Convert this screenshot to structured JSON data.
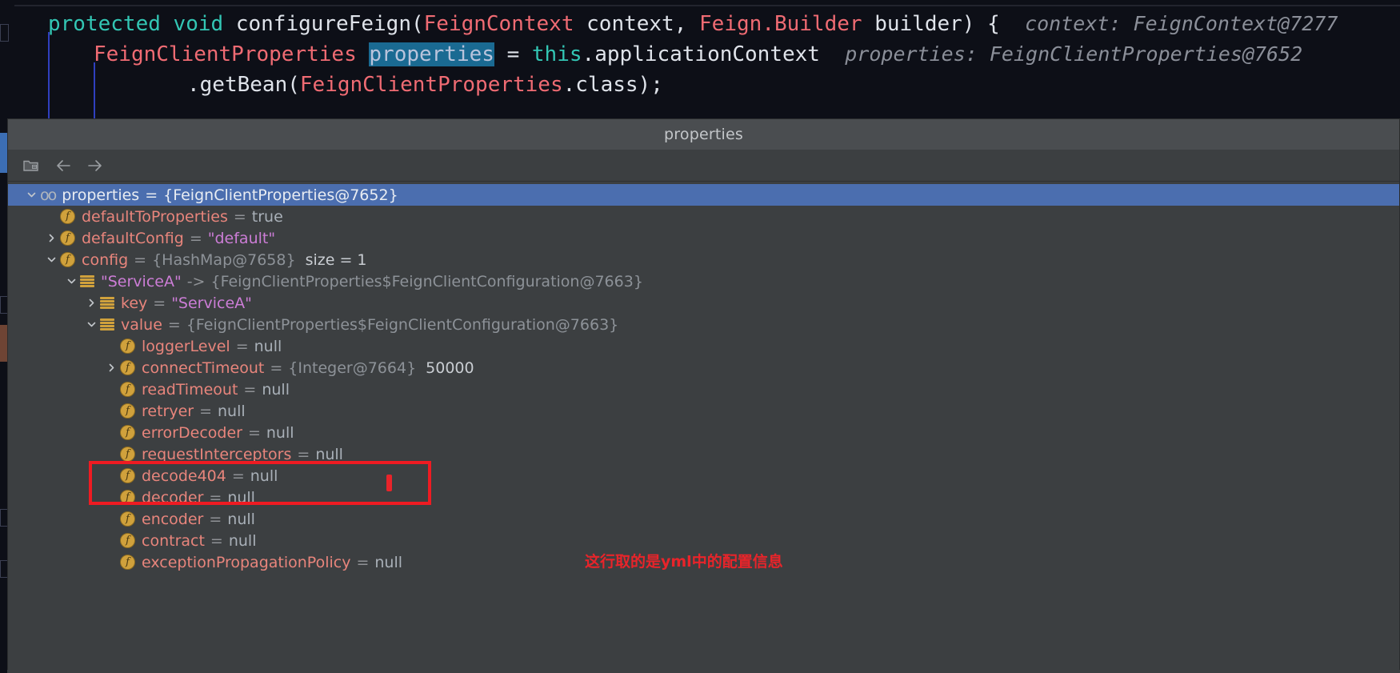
{
  "editor": {
    "line1": {
      "kw_protected": "protected",
      "kw_void": "void",
      "method": "configureFeign",
      "paren_open": "(",
      "type1": "FeignContext",
      "param1": "context",
      "comma": ", ",
      "type2": "Feign",
      "dot": ".",
      "type2b": "Builder",
      "param2": "builder",
      "paren_close": ")",
      "brace": "{",
      "hint": "context: FeignContext@7277"
    },
    "line2": {
      "type": "FeignClientProperties",
      "selected_var": "properties",
      "equals": "=",
      "this_kw": "this",
      "dot": ".",
      "field": "applicationContext",
      "hint": "properties: FeignClientProperties@7652"
    },
    "line3": {
      "call": ".getBean(",
      "arg_type": "FeignClientProperties",
      "arg_rest": ".class);"
    }
  },
  "popup": {
    "title": "properties",
    "toolbar": {
      "items": [
        {
          "name": "show-referring-objects-icon",
          "label": ""
        },
        {
          "name": "back-arrow-icon",
          "label": ""
        },
        {
          "name": "forward-arrow-icon",
          "label": ""
        }
      ]
    },
    "tree": [
      {
        "indent": 0,
        "twisty": "down",
        "icon": "watch-icon",
        "selected": true,
        "name": "properties",
        "eq": "=",
        "value": "{FeignClientProperties@7652}",
        "value_kind": "dim"
      },
      {
        "indent": 1,
        "twisty": "none",
        "icon": "field-icon",
        "selected": false,
        "name": "defaultToProperties",
        "eq": "=",
        "value": "true",
        "value_kind": "plain"
      },
      {
        "indent": 1,
        "twisty": "right",
        "icon": "field-icon",
        "selected": false,
        "name": "defaultConfig",
        "eq": "=",
        "value": "\"default\"",
        "value_kind": "string"
      },
      {
        "indent": 1,
        "twisty": "down",
        "icon": "field-icon",
        "selected": false,
        "name": "config",
        "eq": "=",
        "value": "{HashMap@7658}",
        "value_kind": "dim",
        "extra": "size = 1"
      },
      {
        "indent": 2,
        "twisty": "down",
        "icon": "entry-icon",
        "selected": false,
        "name": "\"ServiceA\"",
        "name_kind": "mapkey",
        "eq": "->",
        "value": "{FeignClientProperties$FeignClientConfiguration@7663}",
        "value_kind": "dim"
      },
      {
        "indent": 3,
        "twisty": "right",
        "icon": "entry-icon",
        "selected": false,
        "name": "key",
        "eq": "=",
        "value": "\"ServiceA\"",
        "value_kind": "string"
      },
      {
        "indent": 3,
        "twisty": "down",
        "icon": "entry-icon",
        "selected": false,
        "name": "value",
        "eq": "=",
        "value": "{FeignClientProperties$FeignClientConfiguration@7663}",
        "value_kind": "dim"
      },
      {
        "indent": 4,
        "twisty": "none",
        "icon": "field-icon",
        "selected": false,
        "name": "loggerLevel",
        "eq": "=",
        "value": "null",
        "value_kind": "plain"
      },
      {
        "indent": 4,
        "twisty": "right",
        "icon": "field-icon",
        "selected": false,
        "name": "connectTimeout",
        "eq": "=",
        "value": "{Integer@7664}",
        "value_kind": "dim",
        "extra": "50000"
      },
      {
        "indent": 4,
        "twisty": "none",
        "icon": "field-icon",
        "selected": false,
        "name": "readTimeout",
        "eq": "=",
        "value": "null",
        "value_kind": "plain"
      },
      {
        "indent": 4,
        "twisty": "none",
        "icon": "field-icon",
        "selected": false,
        "name": "retryer",
        "eq": "=",
        "value": "null",
        "value_kind": "plain"
      },
      {
        "indent": 4,
        "twisty": "none",
        "icon": "field-icon",
        "selected": false,
        "name": "errorDecoder",
        "eq": "=",
        "value": "null",
        "value_kind": "plain"
      },
      {
        "indent": 4,
        "twisty": "none",
        "icon": "field-icon",
        "selected": false,
        "name": "requestInterceptors",
        "eq": "=",
        "value": "null",
        "value_kind": "plain"
      },
      {
        "indent": 4,
        "twisty": "none",
        "icon": "field-icon",
        "selected": false,
        "name": "decode404",
        "eq": "=",
        "value": "null",
        "value_kind": "plain"
      },
      {
        "indent": 4,
        "twisty": "none",
        "icon": "field-icon",
        "selected": false,
        "name": "decoder",
        "eq": "=",
        "value": "null",
        "value_kind": "plain"
      },
      {
        "indent": 4,
        "twisty": "none",
        "icon": "field-icon",
        "selected": false,
        "name": "encoder",
        "eq": "=",
        "value": "null",
        "value_kind": "plain"
      },
      {
        "indent": 4,
        "twisty": "none",
        "icon": "field-icon",
        "selected": false,
        "name": "contract",
        "eq": "=",
        "value": "null",
        "value_kind": "plain"
      },
      {
        "indent": 4,
        "twisty": "none",
        "icon": "field-icon",
        "selected": false,
        "name": "exceptionPropagationPolicy",
        "eq": "=",
        "value": "null",
        "value_kind": "plain"
      }
    ]
  },
  "annotation": {
    "text": "这行取的是yml中的配置信息",
    "color": "#e8242a"
  },
  "colors": {
    "selection_blue": "#4b6eaf",
    "header_gray": "#4a4d50",
    "panel_gray": "#3c3f41",
    "field_name": "#e8857c",
    "string_value": "#cc7dd6",
    "highlight_red": "#ef1b22"
  }
}
